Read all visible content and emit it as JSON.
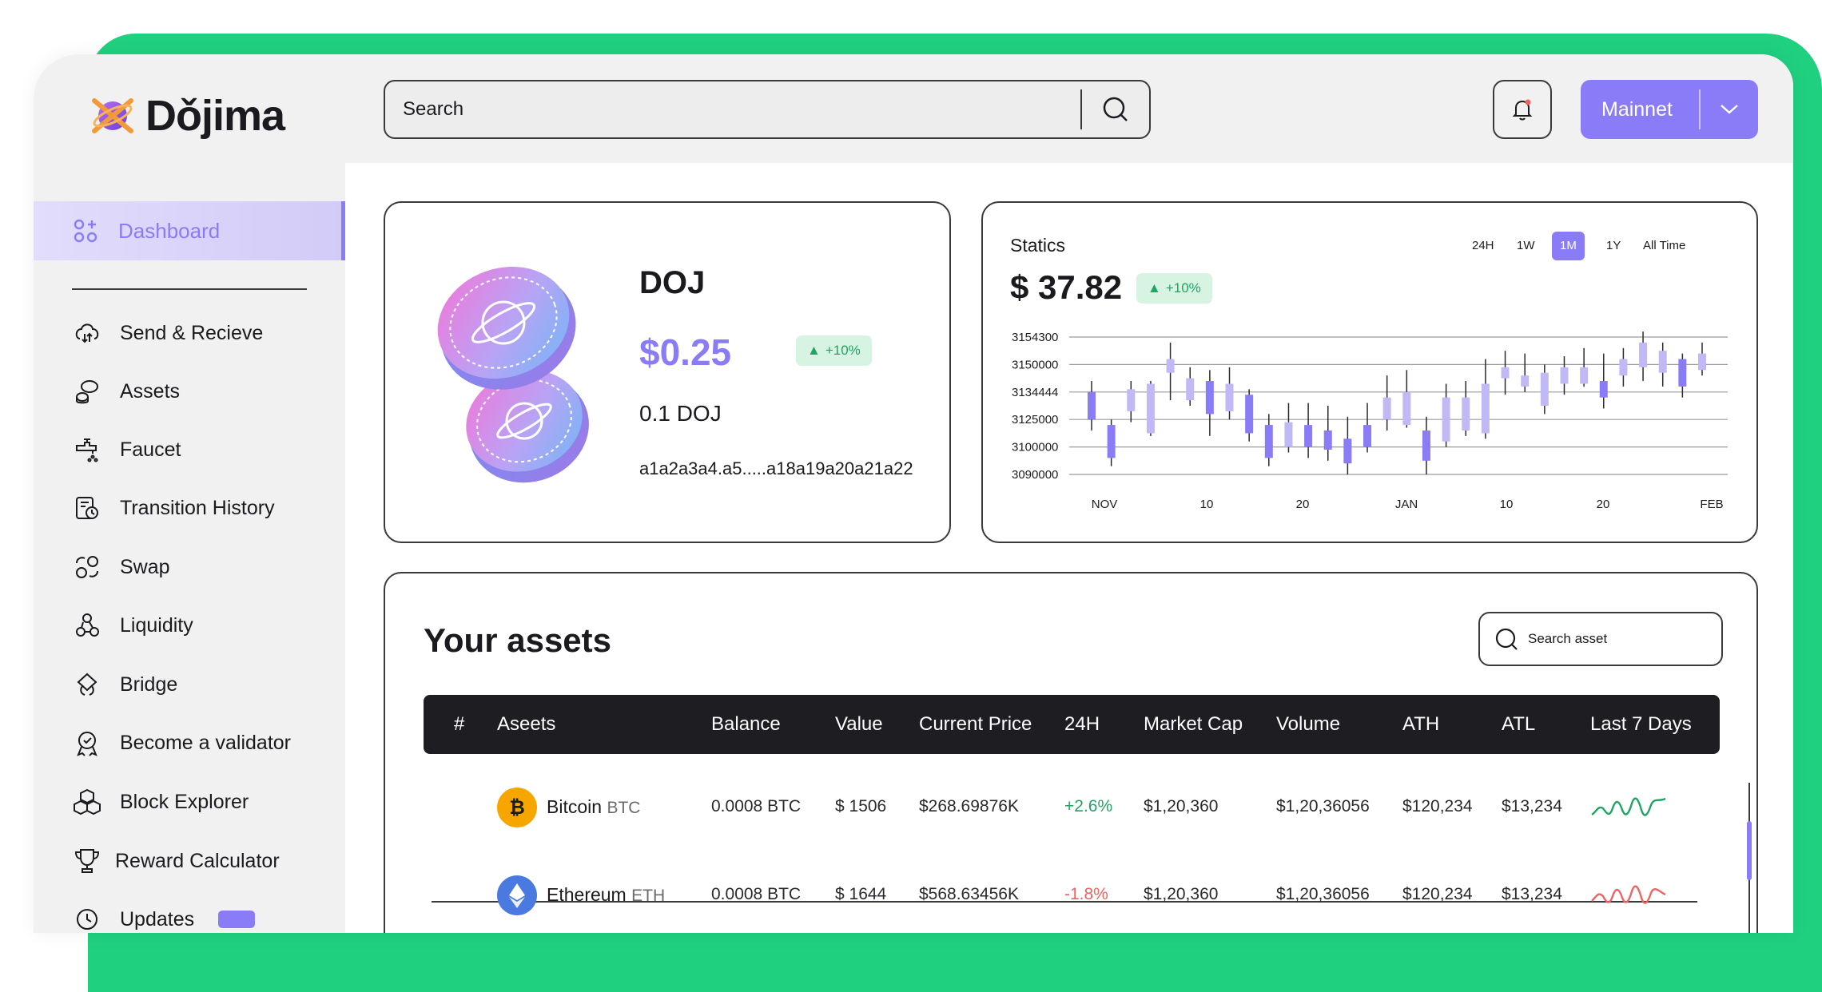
{
  "app": {
    "logo_text": "Dǒjima"
  },
  "sidebar": {
    "active": {
      "label": "Dashboard",
      "icon": "dashboard-grid-icon"
    },
    "items": [
      {
        "label": "Send & Recieve",
        "icon": "send-receive-icon"
      },
      {
        "label": "Assets",
        "icon": "assets-coins-icon"
      },
      {
        "label": "Faucet",
        "icon": "faucet-icon"
      },
      {
        "label": "Transition  History",
        "icon": "history-icon"
      },
      {
        "label": "Swap",
        "icon": "swap-icon"
      },
      {
        "label": "Liquidity",
        "icon": "liquidity-icon"
      },
      {
        "label": "Bridge",
        "icon": "bridge-icon"
      },
      {
        "label": "Become a validator",
        "icon": "validator-badge-icon"
      },
      {
        "label": "Block Explorer",
        "icon": "blocks-icon"
      },
      {
        "label": "Reward Calculator",
        "icon": "trophy-icon"
      },
      {
        "label": "Updates",
        "icon": "updates-icon"
      }
    ]
  },
  "topbar": {
    "search_placeholder": "Search",
    "network": "Mainnet",
    "colors": {
      "accent": "#8a7cf6",
      "frame": "#1fd07f"
    }
  },
  "token": {
    "name": "DOJ",
    "price": "$0.25",
    "change": "+10%",
    "amount": "0.1 DOJ",
    "address": "a1a2a3a4.a5.....a18a19a20a21a22"
  },
  "stats": {
    "title": "Statics",
    "price": "$ 37.82",
    "change": "+10%",
    "timeframes": [
      "24H",
      "1W",
      "1M",
      "1Y",
      "All Time"
    ],
    "active_timeframe": "1M"
  },
  "chart_data": {
    "type": "candlestick",
    "title": "Statics",
    "y_ticks": [
      "3154300",
      "3150000",
      "3134444",
      "3125000",
      "3100000",
      "3090000"
    ],
    "x_ticks": [
      "NOV",
      "10",
      "20",
      "JAN",
      "10",
      "20",
      "FEB"
    ],
    "ohlc_levels": [
      {
        "o": 3,
        "c": 2,
        "h": 3.4,
        "l": 1.6
      },
      {
        "o": 1.8,
        "c": 0.6,
        "h": 2.0,
        "l": 0.3
      },
      {
        "o": 2.3,
        "c": 3.1,
        "h": 3.4,
        "l": 1.9
      },
      {
        "o": 1.5,
        "c": 3.3,
        "h": 3.4,
        "l": 1.4
      },
      {
        "o": 3.7,
        "c": 4.2,
        "h": 4.8,
        "l": 2.7
      },
      {
        "o": 2.7,
        "c": 3.5,
        "h": 3.9,
        "l": 2.5
      },
      {
        "o": 3.4,
        "c": 2.2,
        "h": 3.8,
        "l": 1.4
      },
      {
        "o": 2.3,
        "c": 3.3,
        "h": 3.9,
        "l": 2.0
      },
      {
        "o": 2.9,
        "c": 1.5,
        "h": 3.1,
        "l": 1.2
      },
      {
        "o": 1.8,
        "c": 0.6,
        "h": 2.2,
        "l": 0.3
      },
      {
        "o": 1.0,
        "c": 1.9,
        "h": 2.6,
        "l": 0.8
      },
      {
        "o": 1.8,
        "c": 1.0,
        "h": 2.6,
        "l": 0.6
      },
      {
        "o": 1.6,
        "c": 0.9,
        "h": 2.5,
        "l": 0.5
      },
      {
        "o": 1.3,
        "c": 0.4,
        "h": 2.1,
        "l": 0.0
      },
      {
        "o": 1.8,
        "c": 1.0,
        "h": 2.6,
        "l": 0.8
      },
      {
        "o": 2.0,
        "c": 2.8,
        "h": 3.6,
        "l": 1.6
      },
      {
        "o": 1.8,
        "c": 3.0,
        "h": 3.8,
        "l": 1.7
      },
      {
        "o": 1.6,
        "c": 0.5,
        "h": 2.1,
        "l": 0.0
      },
      {
        "o": 1.2,
        "c": 2.8,
        "h": 3.3,
        "l": 1.0
      },
      {
        "o": 1.6,
        "c": 2.8,
        "h": 3.4,
        "l": 1.4
      },
      {
        "o": 1.5,
        "c": 3.3,
        "h": 4.2,
        "l": 1.3
      },
      {
        "o": 3.5,
        "c": 3.9,
        "h": 4.5,
        "l": 2.9
      },
      {
        "o": 3.2,
        "c": 3.6,
        "h": 4.4,
        "l": 3.0
      },
      {
        "o": 2.5,
        "c": 3.7,
        "h": 4.0,
        "l": 2.2
      },
      {
        "o": 3.3,
        "c": 3.9,
        "h": 4.3,
        "l": 2.9
      },
      {
        "o": 3.3,
        "c": 3.9,
        "h": 4.6,
        "l": 3.2
      },
      {
        "o": 3.4,
        "c": 2.8,
        "h": 4.4,
        "l": 2.4
      },
      {
        "o": 3.6,
        "c": 4.2,
        "h": 4.6,
        "l": 3.2
      },
      {
        "o": 3.9,
        "c": 4.8,
        "h": 5.2,
        "l": 3.4
      },
      {
        "o": 3.7,
        "c": 4.5,
        "h": 4.8,
        "l": 3.2
      },
      {
        "o": 4.2,
        "c": 3.2,
        "h": 4.4,
        "l": 2.8
      },
      {
        "o": 3.8,
        "c": 4.4,
        "h": 4.8,
        "l": 3.6
      }
    ],
    "colors": {
      "bear": "#8a7cf6",
      "bull": "#c1b9f5"
    },
    "grid": true
  },
  "assets": {
    "title": "Your assets",
    "search_placeholder": "Search asset",
    "columns": [
      "#",
      "Aseets",
      "Balance",
      "Value",
      "Current Price",
      "24H",
      "Market Cap",
      "Volume",
      "ATH",
      "ATL",
      "Last 7 Days"
    ],
    "rows": [
      {
        "name": "Bitcoin",
        "symbol": "BTC",
        "balance": "0.0008 BTC",
        "value": "$ 1506",
        "price": "$268.69876K",
        "change": "+2.6%",
        "change_color": "#1fa463",
        "mcap": "$1,20,360",
        "volume": "$1,20,36056",
        "ath": "$120,234",
        "atl": "$13,234",
        "icon": "bitcoin-icon",
        "icon_color": "#f7a600",
        "spark_color": "#1fa463"
      },
      {
        "name": "Ethereum",
        "symbol": "ETH",
        "balance": "0.0008 BTC",
        "value": "$ 1644",
        "price": "$568.63456K",
        "change": "-1.8%",
        "change_color": "#f06262",
        "mcap": "$1,20,360",
        "volume": "$1,20,36056",
        "ath": "$120,234",
        "atl": "$13,234",
        "icon": "ethereum-icon",
        "icon_color": "#4a7ae0",
        "spark_color": "#f06262"
      }
    ]
  }
}
